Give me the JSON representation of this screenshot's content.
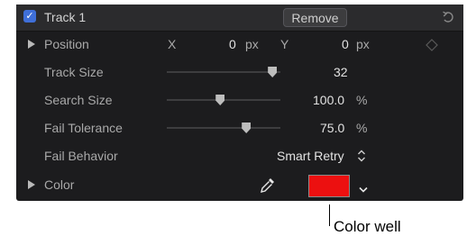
{
  "header": {
    "enabled": true,
    "title": "Track 1",
    "remove_label": "Remove",
    "reset_icon": "reset-arrow-icon"
  },
  "rows": {
    "position": {
      "label": "Position",
      "x_label": "X",
      "x_value": "0",
      "x_unit": "px",
      "y_label": "Y",
      "y_value": "0",
      "y_unit": "px",
      "keyframe_icon": "diamond-icon"
    },
    "track_size": {
      "label": "Track Size",
      "value": "32",
      "slider_fraction": 0.93
    },
    "search_size": {
      "label": "Search Size",
      "value": "100.0",
      "unit": "%",
      "slider_fraction": 0.47
    },
    "fail_tolerance": {
      "label": "Fail Tolerance",
      "value": "75.0",
      "unit": "%",
      "slider_fraction": 0.7
    },
    "fail_behavior": {
      "label": "Fail Behavior",
      "value": "Smart Retry"
    },
    "color": {
      "label": "Color",
      "well_color": "#ec1010",
      "eyedropper_icon": "eyedropper-icon",
      "menu_icon": "chevron-down-icon"
    }
  },
  "callout": {
    "text": "Color well"
  }
}
